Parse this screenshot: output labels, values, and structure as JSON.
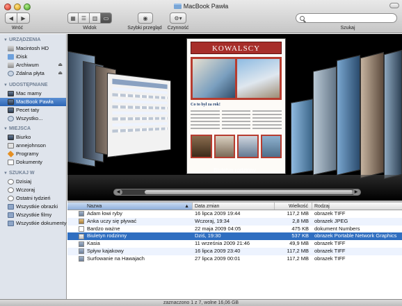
{
  "window": {
    "title": "MacBook Pawła"
  },
  "toolbar": {
    "back_label": "Wróć",
    "view_label": "Widok",
    "quicklook_label": "Szybki przegląd",
    "action_label": "Czynność",
    "search_label": "Szukaj",
    "search_placeholder": ""
  },
  "sidebar": {
    "devices": {
      "title": "URZĄDZENIA",
      "items": [
        {
          "label": "Macintosh HD",
          "icon": "hard-disk-icon"
        },
        {
          "label": "iDisk",
          "icon": "idisk-icon"
        },
        {
          "label": "Archiwum",
          "icon": "external-disk-icon"
        },
        {
          "label": "Zdalna płyta",
          "icon": "remote-disc-icon"
        }
      ]
    },
    "shared": {
      "title": "UDOSTĘPNIANE",
      "items": [
        {
          "label": "Mac mamy"
        },
        {
          "label": "MacBook Pawła",
          "selected": true
        },
        {
          "label": "Pecet taty"
        },
        {
          "label": "Wszystko..."
        }
      ]
    },
    "places": {
      "title": "MIEJSCA",
      "items": [
        {
          "label": "Biurko"
        },
        {
          "label": "annejohnson"
        },
        {
          "label": "Programy"
        },
        {
          "label": "Dokumenty"
        }
      ]
    },
    "search_for": {
      "title": "SZUKAJ W",
      "items": [
        {
          "label": "Dzisiaj"
        },
        {
          "label": "Wczoraj"
        },
        {
          "label": "Ostatni tydzień"
        },
        {
          "label": "Wszystkie obrazki"
        },
        {
          "label": "Wszystkie filmy"
        },
        {
          "label": "Wszystkie dokumenty"
        }
      ]
    }
  },
  "coverflow": {
    "caption": "Biuletyn rodzinny",
    "newsletter_title": "KOWALSCY",
    "newsletter_subtitle": "Co to był za rok!"
  },
  "list": {
    "columns": {
      "name": "Nazwa",
      "date": "Data zmian",
      "size": "Wielkość",
      "kind": "Rodzaj"
    },
    "rows": [
      {
        "name": "Adam łowi ryby",
        "date": "16 lipca 2009 19:44",
        "size": "117,2 MB",
        "kind": "obrazek TIFF"
      },
      {
        "name": "Anka uczy się pływać",
        "date": "Wczoraj, 19:34",
        "size": "2,8 MB",
        "kind": "obrazek JPEG"
      },
      {
        "name": "Bardzo ważne",
        "date": "22 maja 2009 04:05",
        "size": "475 KB",
        "kind": "dokument Numbers"
      },
      {
        "name": "Biuletyn rodzinny",
        "date": "Dziś, 19:30",
        "size": "537 KB",
        "kind": "obrazek Portable Network Graphics",
        "selected": true
      },
      {
        "name": "Kasia",
        "date": "11 września 2009 21:46",
        "size": "49,9 MB",
        "kind": "obrazek TIFF"
      },
      {
        "name": "Spływ kajakowy",
        "date": "16 lipca 2009 23:40",
        "size": "117,2 MB",
        "kind": "obrazek TIFF"
      },
      {
        "name": "Surfowanie na Hawajach",
        "date": "27 lipca 2009 00:01",
        "size": "117,2 MB",
        "kind": "obrazek TIFF"
      }
    ]
  },
  "status": {
    "text": "zaznaczono 1 z 7, wolne 16,06 GB"
  }
}
